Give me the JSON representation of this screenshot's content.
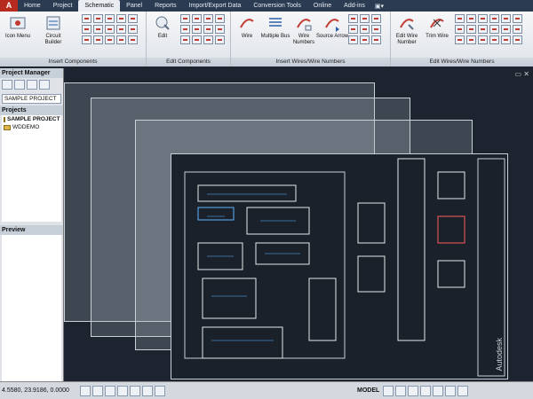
{
  "app_button": "A",
  "tabs": [
    "Home",
    "Project",
    "Schematic",
    "Panel",
    "Reports",
    "Import/Export Data",
    "Conversion Tools",
    "Online",
    "Add-ins"
  ],
  "active_tab": "Schematic",
  "ribbon": {
    "insert_components": {
      "title": "Insert Components",
      "buttons": [
        "Icon Menu",
        "Circuit Builder"
      ]
    },
    "edit_components": {
      "title": "Edit Components",
      "buttons": [
        "Edit"
      ]
    },
    "insert_wires": {
      "title": "Insert Wires/Wire Numbers",
      "buttons": [
        "Wire",
        "Multiple Bus",
        "Wire Numbers",
        "Source Arrow"
      ]
    },
    "edit_wires": {
      "title": "Edit Wires/Wire Numbers",
      "buttons": [
        "Edit Wire Number",
        "Trim Wire"
      ]
    }
  },
  "project_manager": {
    "title": "Project Manager",
    "current_project": "SAMPLE PROJECT",
    "projects_header": "Projects",
    "projects": [
      "SAMPLE PROJECT",
      "WDDEMO"
    ],
    "preview_header": "Preview"
  },
  "status": {
    "coordinates": "4.5580, 23.9186, 0.0000",
    "model_label": "MODEL"
  },
  "drawing": {
    "brand_text": "Autodesk"
  }
}
